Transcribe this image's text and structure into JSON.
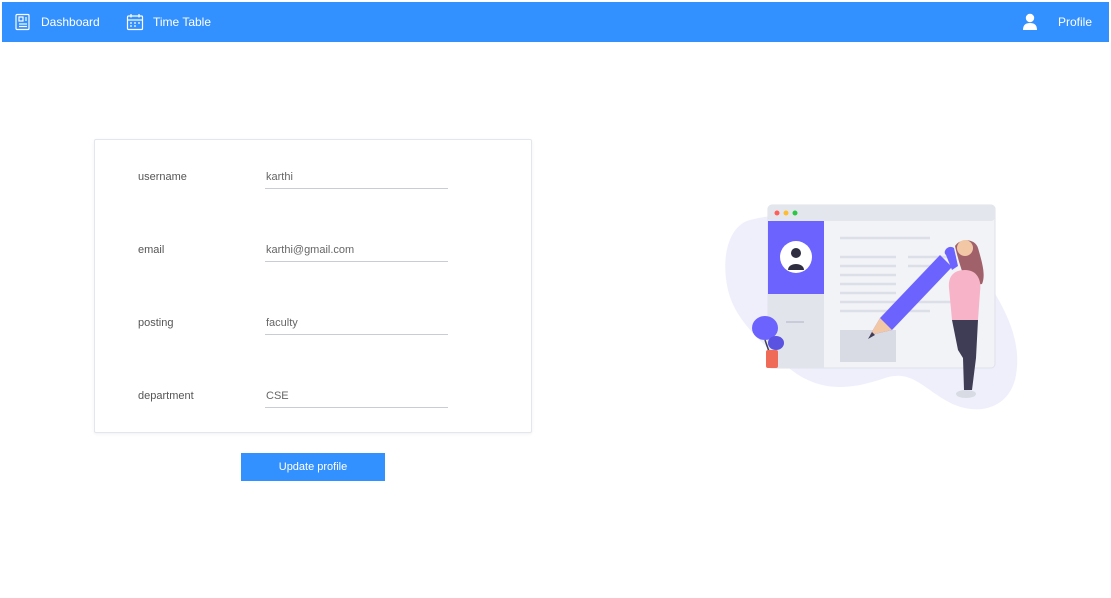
{
  "nav": {
    "dashboard_label": "Dashboard",
    "timetable_label": "Time Table",
    "profile_label": "Profile"
  },
  "form": {
    "fields": [
      {
        "label": "username",
        "value": "karthi"
      },
      {
        "label": "email",
        "value": "karthi@gmail.com"
      },
      {
        "label": "posting",
        "value": "faculty"
      },
      {
        "label": "department",
        "value": "CSE"
      }
    ],
    "submit_label": "Update profile"
  },
  "colors": {
    "primary": "#3390ff",
    "illustration_accent": "#6c63ff",
    "illustration_pink": "#f7b3c8"
  },
  "icons": {
    "dashboard": "dashboard-icon",
    "timetable": "calendar-icon",
    "profile": "user-icon"
  }
}
